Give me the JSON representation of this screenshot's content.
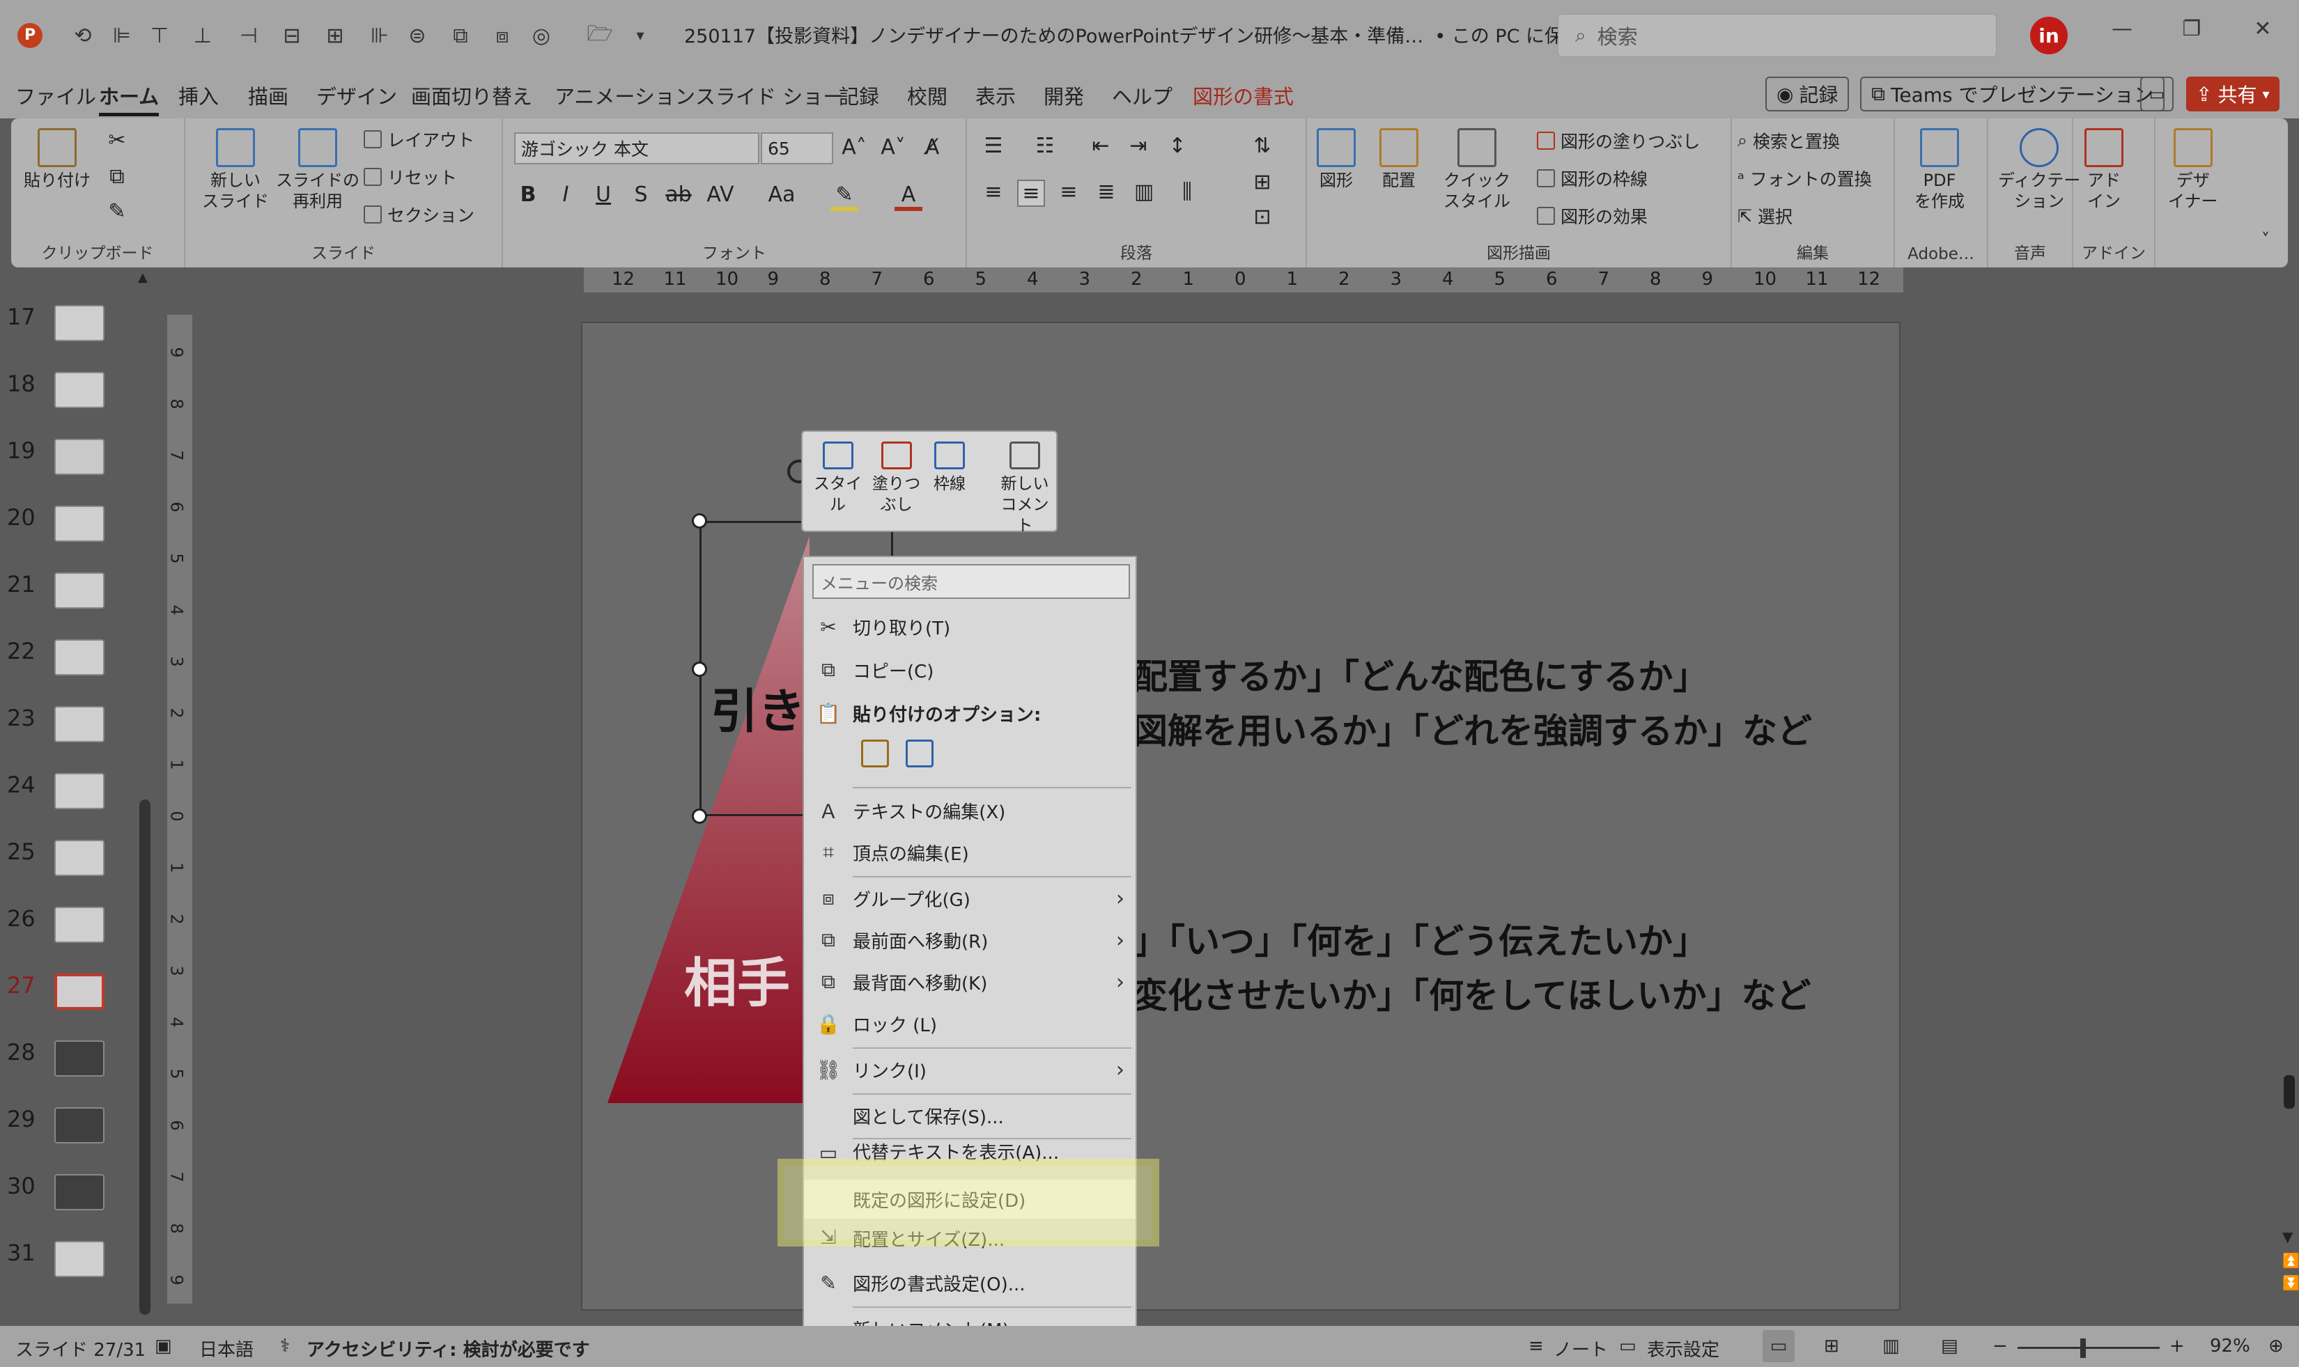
{
  "app": {
    "name": "PowerPoint",
    "colors": {
      "accent": "#c43e1c",
      "highlight": "#f3f26b",
      "triangle_top": "#c1858d",
      "triangle_bottom": "#8a0b1f",
      "avatar": "#c21b17"
    }
  },
  "titlebar": {
    "title": "250117【投影資料】ノンデザイナーのためのPowerPointデザイン研修～基本・準備…",
    "save_status": "• この PC に保存済み",
    "search_placeholder": "検索",
    "avatar_label": "in",
    "quick_access_icons": [
      "powerpoint-logo-icon",
      "autosave-icon",
      "align-left-icon",
      "align-top-icon",
      "align-bottom-icon",
      "align-right-icon",
      "align-center-icon",
      "distribute-icon",
      "distribute-v-icon",
      "align-middle-icon",
      "group-icon",
      "ungroup-icon",
      "shape-icon",
      "open-folder-icon",
      "customize-icon"
    ]
  },
  "menubar": {
    "tabs": [
      "ファイル",
      "ホーム",
      "挿入",
      "描画",
      "デザイン",
      "画面切り替え",
      "アニメーション",
      "スライド ショー",
      "記録",
      "校閲",
      "表示",
      "開発",
      "ヘルプ",
      "図形の書式"
    ],
    "active_tab": "ホーム",
    "record_button": "記録",
    "teams_button": "Teams でプレゼンテーション",
    "share_button": "共有"
  },
  "ribbon": {
    "clipboard": {
      "name": "クリップボード",
      "paste": "貼り付け"
    },
    "slides": {
      "name": "スライド",
      "new_slide": "新しい",
      "new_slide2": "スライド",
      "reuse": "スライドの",
      "reuse2": "再利用",
      "layout": "レイアウト",
      "reset": "リセット",
      "section": "セクション"
    },
    "font": {
      "name": "フォント",
      "font_name": "游ゴシック 本文",
      "font_size": "65"
    },
    "paragraph": {
      "name": "段落"
    },
    "drawing": {
      "name": "図形描画",
      "shapes": "図形",
      "arrange": "配置",
      "quick_styles": "クイック",
      "quick_styles2": "スタイル",
      "fill": "図形の塗りつぶし",
      "outline": "図形の枠線",
      "effects": "図形の効果"
    },
    "editing": {
      "name": "編集",
      "find": "検索と置換",
      "replace_font": "フォントの置換",
      "select": "選択"
    },
    "adobe": {
      "name": "Adobe…",
      "pdf": "PDF",
      "pdf2": "を作成"
    },
    "voice": {
      "name": "音声",
      "dictate": "ディクテー",
      "dictate2": "ション"
    },
    "addins": {
      "name": "アドイン",
      "addins_btn": "アド",
      "addins_btn2": "イン"
    },
    "designer": {
      "designer_btn": "デザ",
      "designer_btn2": "イナー"
    }
  },
  "thumbnails": {
    "slides": [
      "17",
      "18",
      "19",
      "20",
      "21",
      "22",
      "23",
      "24",
      "25",
      "26",
      "27",
      "28",
      "29",
      "30",
      "31"
    ],
    "active": "27"
  },
  "ruler": {
    "h_ticks": [
      "12",
      "11",
      "10",
      "9",
      "8",
      "7",
      "6",
      "5",
      "4",
      "3",
      "2",
      "1",
      "0",
      "1",
      "2",
      "3",
      "4",
      "5",
      "6",
      "7",
      "8",
      "9",
      "10",
      "11",
      "12"
    ],
    "v_ticks": [
      "9",
      "8",
      "7",
      "6",
      "5",
      "4",
      "3",
      "2",
      "1",
      "0",
      "1",
      "2",
      "3",
      "4",
      "5",
      "6",
      "7",
      "8",
      "9"
    ]
  },
  "slide": {
    "label_top": "引き",
    "label_bottom": "相手",
    "line1": "配置するか」「どんな配色にするか」",
    "line2": "図解を用いるか」「どれを強調するか」など",
    "line3": "」「いつ」「何を」「どう伝えたいか」",
    "line4": "変化させたいか」「何をしてほしいか」など"
  },
  "mini_toolbar": {
    "style1": "スタイ",
    "style2": "ル",
    "fill1": "塗りつ",
    "fill2": "ぶし",
    "outline": "枠線",
    "comment1": "新しい",
    "comment2": "コメント"
  },
  "context_menu": {
    "search_placeholder": "メニューの検索",
    "items": {
      "cut": "切り取り(T)",
      "copy": "コピー(C)",
      "paste_options": "貼り付けのオプション:",
      "edit_text": "テキストの編集(X)",
      "edit_points": "頂点の編集(E)",
      "group": "グループ化(G)",
      "bring_front": "最前面へ移動(R)",
      "send_back": "最背面へ移動(K)",
      "lock": "ロック (L)",
      "link": "リンク(I)",
      "save_as_picture": "図として保存(S)...",
      "alt_text": "代替テキストを表示(A)...",
      "set_default": "既定の図形に設定(D)",
      "size_position": "配置とサイズ(Z)...",
      "format_shape": "図形の書式設定(O)...",
      "new_comment": "新しいコメント(M)"
    }
  },
  "statusbar": {
    "slide_indicator": "スライド 27/31",
    "language": "日本語",
    "accessibility": "アクセシビリティ: 検討が必要です",
    "notes": "ノート",
    "display_settings": "表示設定",
    "zoom": "92%"
  }
}
